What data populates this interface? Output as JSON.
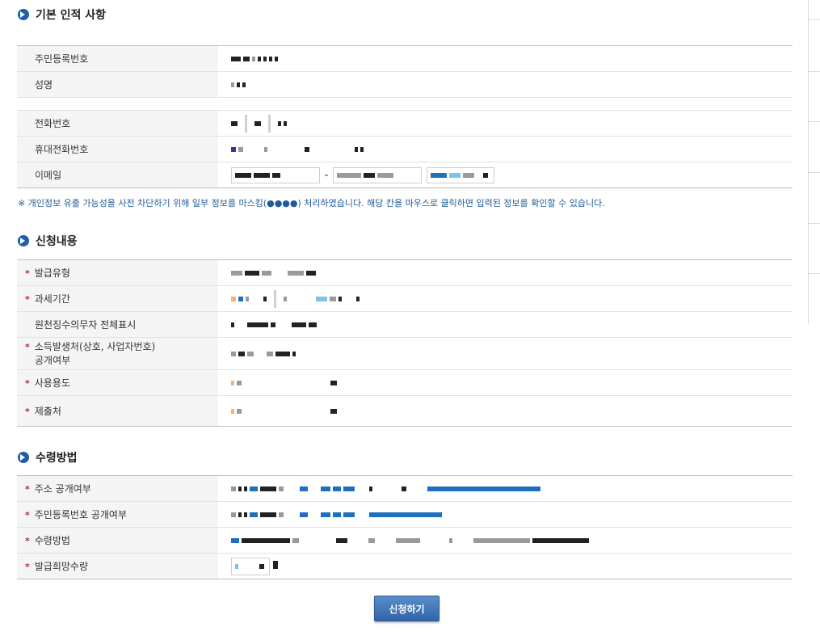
{
  "sections": {
    "personal": {
      "title": "기본 인적 사항"
    },
    "request": {
      "title": "신청내용"
    },
    "receipt": {
      "title": "수령방법"
    }
  },
  "personal_rows": {
    "rrn": "주민등록번호",
    "name": "성명",
    "phone": "전화번호",
    "mobile": "휴대전화번호",
    "email": "이메일"
  },
  "notice": "※ 개인정보 유출 가능성을 사전 차단하기 위해 일부 정보를 마스킹(●●●●) 처리하였습니다. 해당 칸을 마우스로 클릭하면 입력된 정보를 확인할 수 있습니다.",
  "request_rows": {
    "issue_type": "발급유형",
    "tax_period": "과세기간",
    "withholding_display": "원천징수의무자 전체표시",
    "income_source_line1": "소득발생처(상호, 사업자번호)",
    "income_source_line2": "공개여부",
    "usage": "사용용도",
    "submit_to": "제출처"
  },
  "receipt_rows": {
    "address_public": "주소 공개여부",
    "rrn_public": "주민등록번호 공개여부",
    "method": "수령방법",
    "copies": "발급희망수량"
  },
  "required_mark": "*",
  "submit_label": "신청하기",
  "colors": {
    "accent": "#1e5fa8",
    "required": "#c0262d",
    "notice": "#1e5b9a"
  }
}
